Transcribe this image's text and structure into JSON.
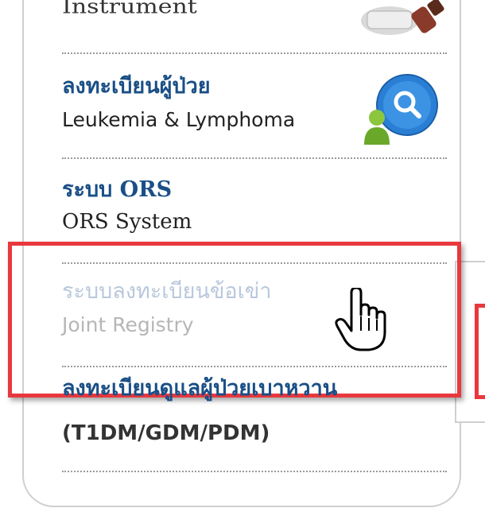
{
  "menu": {
    "items": [
      {
        "thai": "",
        "english": "Instrument",
        "icon": "instrument-icon"
      },
      {
        "thai": "ลงทะเบียนผู้ป่วย",
        "english": "Leukemia & Lymphoma",
        "icon": "search-user-icon"
      },
      {
        "thai": "ระบบ ORS",
        "english": "ORS System"
      },
      {
        "thai": "ระบบลงทะเบียนข้อเข่า",
        "english": "Joint Registry",
        "state": "hovered"
      },
      {
        "thai": "ลงทะเบียนดูแลผู้ป่วยเบาหวาน",
        "english": "(T1DM/GDM/PDM)"
      }
    ]
  },
  "annotation": {
    "highlight_color": "#e8383d"
  },
  "cursor": "hand-pointer-icon"
}
